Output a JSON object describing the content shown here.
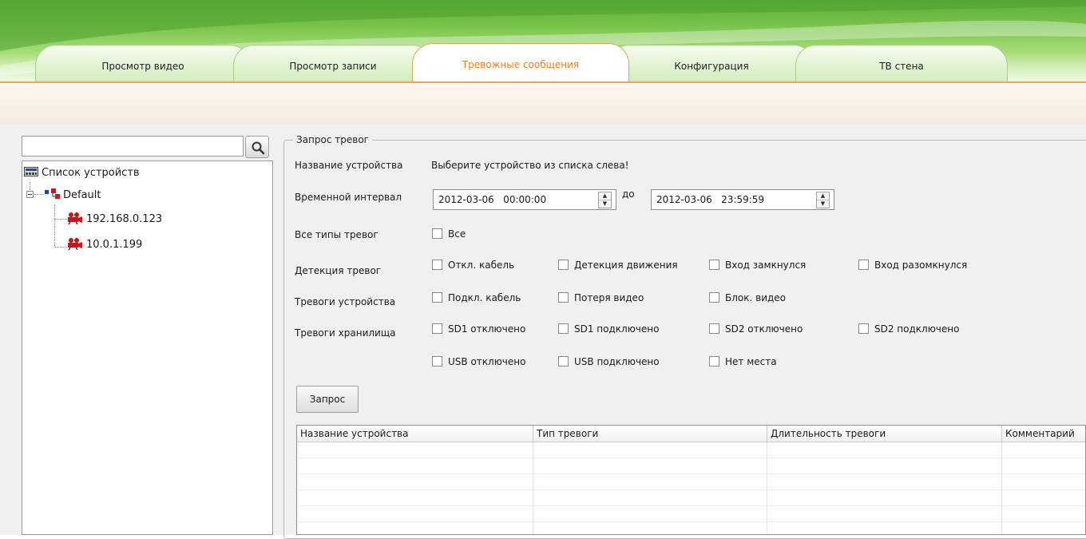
{
  "tabs": [
    {
      "label": "Просмотр видео",
      "active": false
    },
    {
      "label": "Просмотр записи",
      "active": false
    },
    {
      "label": "Тревожные сообщения",
      "active": true
    },
    {
      "label": "Конфигурация",
      "active": false
    },
    {
      "label": "ТВ стена",
      "active": false
    }
  ],
  "sidebar": {
    "search_value": "",
    "root_label": "Список устройств",
    "group_label": "Default",
    "devices": [
      "192.168.0.123",
      "10.0.1.199"
    ]
  },
  "query": {
    "group_title": "Запрос тревог",
    "device_name_label": "Название устройства",
    "device_name_hint": "Выберите устройство из списка слева!",
    "time_label": "Временной интервал",
    "time_from": "2012-03-06   00:00:00",
    "time_sep": "до",
    "time_to": "2012-03-06   23:59:59",
    "all_types_label": "Все типы тревог",
    "all_checkbox": "Все",
    "detection_label": "Детекция тревог",
    "detection": [
      "Откл. кабель",
      "Детекция движения",
      "Вход замкнулся",
      "Вход разомкнулся"
    ],
    "device_alarms_label": "Тревоги устройства",
    "device_alarms": [
      "Подкл. кабель",
      "Потеря видео",
      "Блок. видео"
    ],
    "storage_label": "Тревоги хранилища",
    "storage_row1": [
      "SD1 отключено",
      "SD1 подключено",
      "SD2 отключено",
      "SD2 подключено"
    ],
    "storage_row2": [
      "USB отключено",
      "USB подключено",
      "Нет места"
    ],
    "query_button": "Запрос"
  },
  "results": {
    "columns": [
      "Название устройства",
      "Тип тревоги",
      "Длительность тревоги",
      "Комментарий"
    ],
    "rows": []
  },
  "colors": {
    "accent_green": "#78c24a",
    "active_tab_text": "#e8801e",
    "device_icon": "#c01818"
  }
}
